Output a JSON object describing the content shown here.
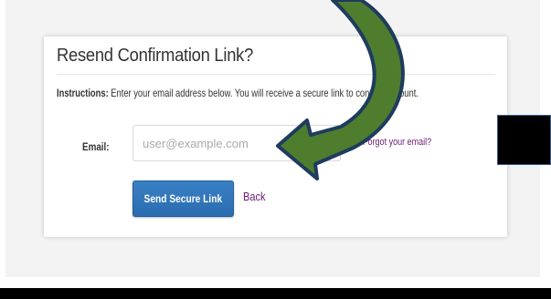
{
  "card": {
    "title": "Resend Confirmation Link?",
    "instructions_label": "Instructions:",
    "instructions_text": " Enter your email address below. You will receive a secure link to confirm account."
  },
  "form": {
    "email_label": "Email:",
    "email_placeholder": "user@example.com",
    "email_value": "",
    "forgot_link": "Forgot your email?",
    "send_button": "Send Secure Link",
    "back_link": "Back"
  },
  "colors": {
    "button": "#2b6cb0",
    "link": "#6a1b73",
    "arrow_fill": "#4e7d2e",
    "arrow_outline": "#1f3b5e"
  },
  "annotations": {
    "arrow_icon": "curved-arrow-icon",
    "redaction_box": "redaction-box"
  }
}
